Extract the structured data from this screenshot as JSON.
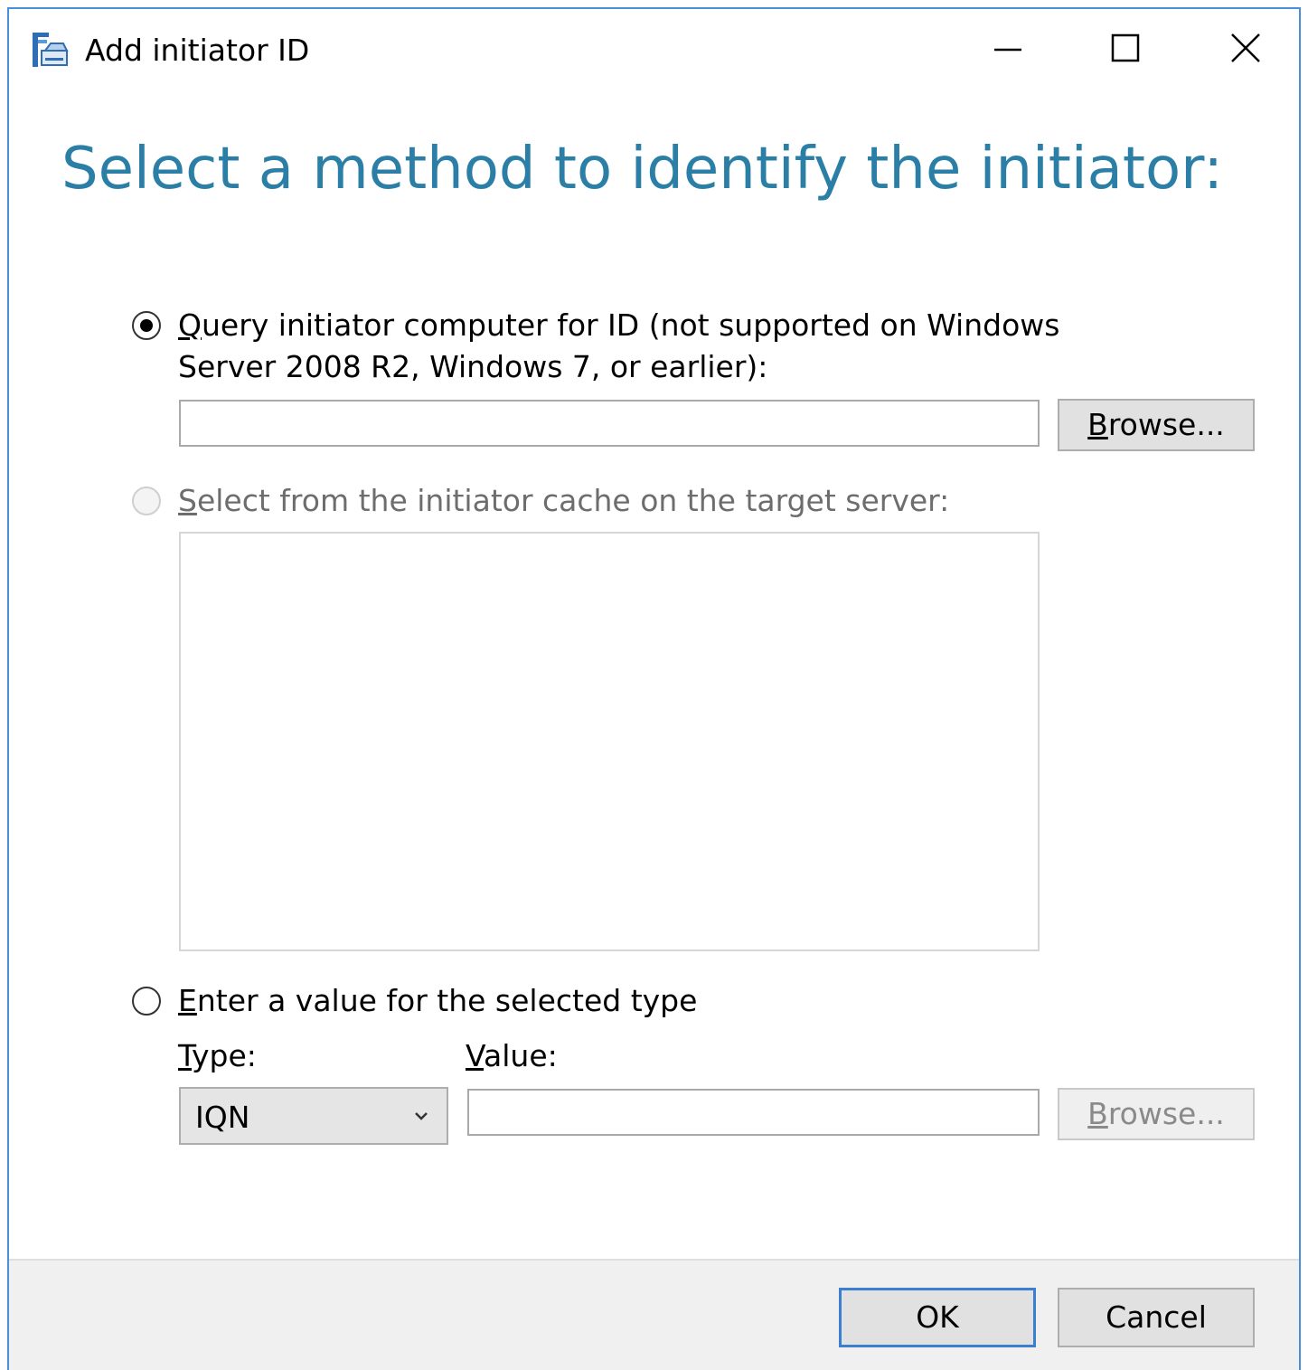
{
  "window": {
    "title": "Add initiator ID",
    "minimize_icon": "minimize-icon",
    "maximize_icon": "maximize-icon",
    "close_icon": "close-icon",
    "app_icon": "server-storage-icon"
  },
  "heading": "Select a method to identify the initiator:",
  "options": {
    "query": {
      "selected": true,
      "label_mnemonic": "Q",
      "label_line1_rest": "uery initiator computer for ID (not supported on Windows",
      "label_line2": "Server 2008 R2, Windows 7, or earlier):",
      "input_value": "",
      "browse_mnemonic": "B",
      "browse_rest": "rowse..."
    },
    "cache": {
      "selected": false,
      "enabled": false,
      "label_mnemonic": "S",
      "label_rest": "elect from the initiator cache on the target server:",
      "items": []
    },
    "manual": {
      "selected": false,
      "label_mnemonic": "E",
      "label_rest": "nter a value for the selected type",
      "type_label_mnemonic": "T",
      "type_label_rest": "ype:",
      "type_value": "IQN",
      "value_label_mnemonic": "V",
      "value_label_rest": "alue:",
      "value_input": "",
      "browse_mnemonic": "B",
      "browse_rest": "rowse..."
    }
  },
  "footer": {
    "ok_label": "OK",
    "cancel_label": "Cancel"
  },
  "colors": {
    "heading": "#2b7fa6",
    "window_border": "#4a90d9",
    "footer_bg": "#f0f0f0",
    "default_button_border": "#3c7fd1"
  }
}
